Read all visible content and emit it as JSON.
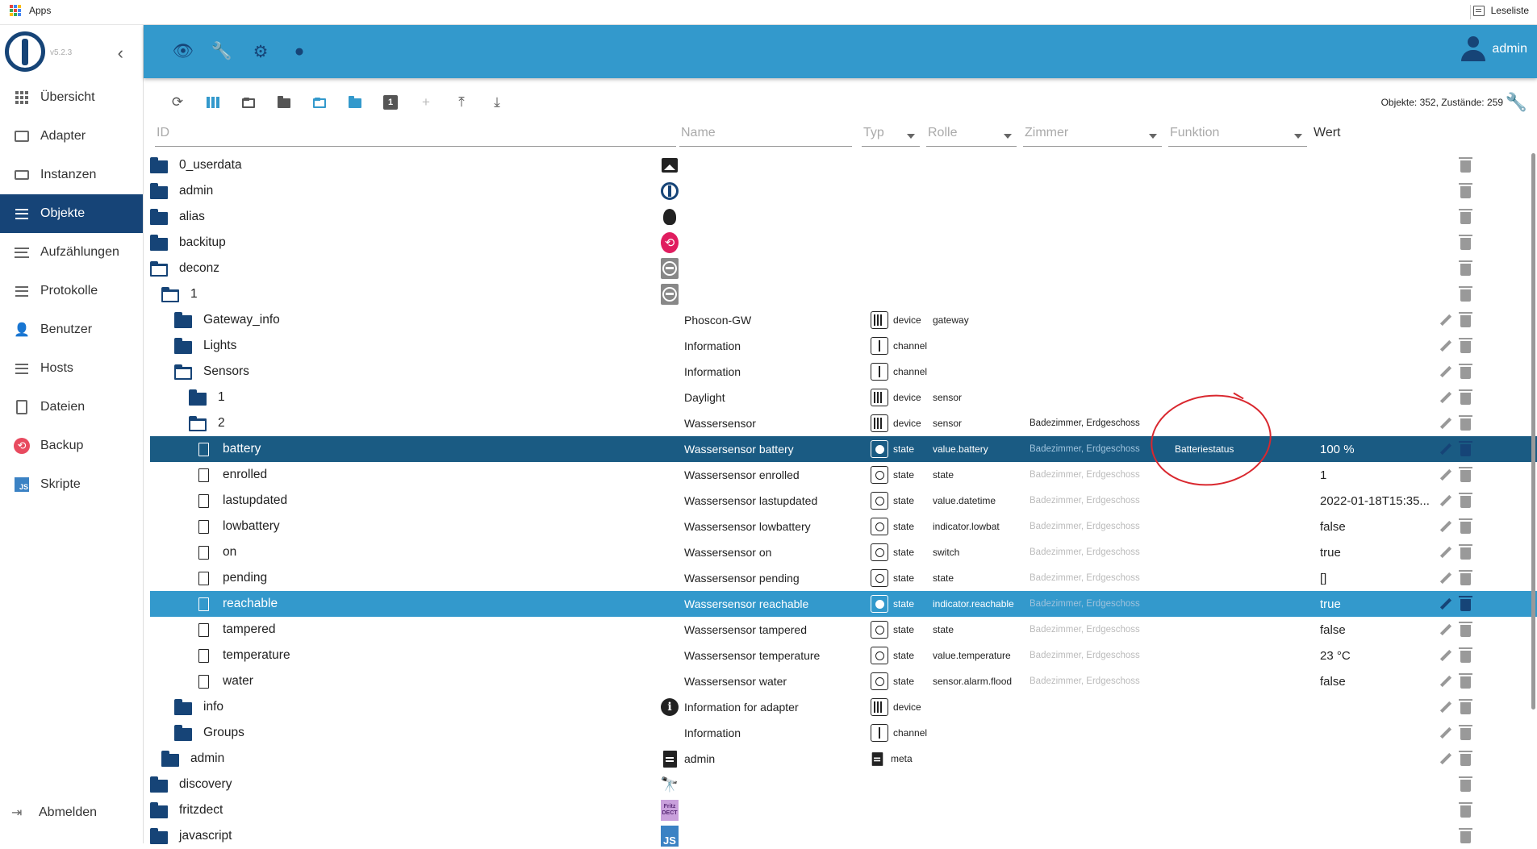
{
  "browser": {
    "apps_label": "Apps",
    "reading_list": "Leseliste"
  },
  "app": {
    "version": "v5.2.3",
    "user": "admin"
  },
  "sidebar": {
    "items": [
      {
        "label": "Übersicht",
        "icon": "grid-icon"
      },
      {
        "label": "Adapter",
        "icon": "store-icon"
      },
      {
        "label": "Instanzen",
        "icon": "instances-icon"
      },
      {
        "label": "Objekte",
        "icon": "list-icon",
        "active": true
      },
      {
        "label": "Aufzählungen",
        "icon": "enum-icon"
      },
      {
        "label": "Protokolle",
        "icon": "log-icon"
      },
      {
        "label": "Benutzer",
        "icon": "user-icon"
      },
      {
        "label": "Hosts",
        "icon": "hosts-icon"
      },
      {
        "label": "Dateien",
        "icon": "files-icon"
      },
      {
        "label": "Backup",
        "icon": "backup-icon"
      },
      {
        "label": "Skripte",
        "icon": "js-icon"
      }
    ],
    "logout": "Abmelden"
  },
  "toolbar": {
    "stats": "Objekte: 352, Zustände: 259",
    "one_badge": "1"
  },
  "columns": {
    "id": "ID",
    "name": "Name",
    "type": "Typ",
    "role": "Rolle",
    "room": "Zimmer",
    "function": "Funktion",
    "value": "Wert"
  },
  "colors": {
    "header": "#3399cc",
    "sidebar_active": "#164477",
    "selected_row": "#1a5b83",
    "highlight_row": "#3399cc",
    "annotation": "#d9282f"
  },
  "rows": [
    {
      "id": "0_userdata",
      "kind": "folder",
      "depth": 0,
      "icon": "image",
      "name": "",
      "type": "",
      "role": "",
      "room": "",
      "func": "",
      "value": ""
    },
    {
      "id": "admin",
      "kind": "folder",
      "depth": 0,
      "icon": "iob",
      "name": "",
      "type": "",
      "role": "",
      "room": "",
      "func": "",
      "value": ""
    },
    {
      "id": "alias",
      "kind": "folder",
      "depth": 0,
      "icon": "bulb",
      "name": "",
      "type": "",
      "role": "",
      "room": "",
      "func": "",
      "value": ""
    },
    {
      "id": "backitup",
      "kind": "folder",
      "depth": 0,
      "icon": "backitup",
      "name": "",
      "type": "",
      "role": "",
      "room": "",
      "func": "",
      "value": ""
    },
    {
      "id": "deconz",
      "kind": "folder-open",
      "depth": 0,
      "icon": "deconz",
      "name": "",
      "type": "",
      "role": "",
      "room": "",
      "func": "",
      "value": ""
    },
    {
      "id": "1",
      "kind": "folder-open",
      "depth": 1,
      "icon": "deconz",
      "name": "",
      "type": "",
      "role": "",
      "room": "",
      "func": "",
      "value": ""
    },
    {
      "id": "Gateway_info",
      "kind": "folder",
      "depth": 2,
      "icon": "",
      "name": "Phoscon-GW",
      "type": "device",
      "role": "gateway",
      "room": "",
      "func": "",
      "value": "",
      "edit": true
    },
    {
      "id": "Lights",
      "kind": "folder",
      "depth": 2,
      "icon": "",
      "name": "Information",
      "type": "channel",
      "role": "",
      "room": "",
      "func": "",
      "value": "",
      "edit": true
    },
    {
      "id": "Sensors",
      "kind": "folder-open",
      "depth": 2,
      "icon": "",
      "name": "Information",
      "type": "channel",
      "role": "",
      "room": "",
      "func": "",
      "value": "",
      "edit": true
    },
    {
      "id": "1",
      "kind": "folder",
      "depth": 3,
      "icon": "",
      "name": "Daylight",
      "type": "device",
      "role": "sensor",
      "room": "",
      "func": "",
      "value": "",
      "edit": true
    },
    {
      "id": "2",
      "kind": "folder-open",
      "depth": 3,
      "icon": "",
      "name": "Wassersensor",
      "type": "device",
      "role": "sensor",
      "room": "Badezimmer, Erdgeschoss",
      "room_dark": true,
      "func": "",
      "value": "",
      "edit": true
    },
    {
      "id": "battery",
      "kind": "file",
      "depth": 4,
      "icon": "",
      "name": "Wassersensor battery",
      "type": "state",
      "role": "value.battery",
      "room": "Badezimmer, Erdgeschoss",
      "func": "Batteriestatus",
      "value": "100 %",
      "edit": true,
      "sel": "dark"
    },
    {
      "id": "enrolled",
      "kind": "file",
      "depth": 4,
      "icon": "",
      "name": "Wassersensor enrolled",
      "type": "state",
      "role": "state",
      "room": "Badezimmer, Erdgeschoss",
      "func": "",
      "value": "1",
      "edit": true
    },
    {
      "id": "lastupdated",
      "kind": "file",
      "depth": 4,
      "icon": "",
      "name": "Wassersensor lastupdated",
      "type": "state",
      "role": "value.datetime",
      "room": "Badezimmer, Erdgeschoss",
      "func": "",
      "value": "2022-01-18T15:35...",
      "edit": true
    },
    {
      "id": "lowbattery",
      "kind": "file",
      "depth": 4,
      "icon": "",
      "name": "Wassersensor lowbattery",
      "type": "state",
      "role": "indicator.lowbat",
      "room": "Badezimmer, Erdgeschoss",
      "func": "",
      "value": "false",
      "edit": true
    },
    {
      "id": "on",
      "kind": "file",
      "depth": 4,
      "icon": "",
      "name": "Wassersensor on",
      "type": "state",
      "role": "switch",
      "room": "Badezimmer, Erdgeschoss",
      "func": "",
      "value": "true",
      "edit": true
    },
    {
      "id": "pending",
      "kind": "file",
      "depth": 4,
      "icon": "",
      "name": "Wassersensor pending",
      "type": "state",
      "role": "state",
      "room": "Badezimmer, Erdgeschoss",
      "func": "",
      "value": "[]",
      "edit": true
    },
    {
      "id": "reachable",
      "kind": "file",
      "depth": 4,
      "icon": "",
      "name": "Wassersensor reachable",
      "type": "state",
      "role": "indicator.reachable",
      "room": "Badezimmer, Erdgeschoss",
      "func": "",
      "value": "true",
      "edit": true,
      "sel": "blue"
    },
    {
      "id": "tampered",
      "kind": "file",
      "depth": 4,
      "icon": "",
      "name": "Wassersensor tampered",
      "type": "state",
      "role": "state",
      "room": "Badezimmer, Erdgeschoss",
      "func": "",
      "value": "false",
      "edit": true
    },
    {
      "id": "temperature",
      "kind": "file",
      "depth": 4,
      "icon": "",
      "name": "Wassersensor temperature",
      "type": "state",
      "role": "value.temperature",
      "room": "Badezimmer, Erdgeschoss",
      "func": "",
      "value": "23 °C",
      "edit": true
    },
    {
      "id": "water",
      "kind": "file",
      "depth": 4,
      "icon": "",
      "name": "Wassersensor water",
      "type": "state",
      "role": "sensor.alarm.flood",
      "room": "Badezimmer, Erdgeschoss",
      "func": "",
      "value": "false",
      "edit": true
    },
    {
      "id": "info",
      "kind": "folder",
      "depth": 2,
      "icon": "info",
      "name": "Information for adapter",
      "type": "device",
      "role": "",
      "room": "",
      "func": "",
      "value": "",
      "edit": true
    },
    {
      "id": "Groups",
      "kind": "folder",
      "depth": 2,
      "icon": "",
      "name": "Information",
      "type": "channel",
      "role": "",
      "room": "",
      "func": "",
      "value": "",
      "edit": true
    },
    {
      "id": "admin",
      "kind": "folder",
      "depth": 1,
      "icon": "doc",
      "name": "admin",
      "type": "meta",
      "role": "",
      "room": "",
      "func": "",
      "value": "",
      "edit": true
    },
    {
      "id": "discovery",
      "kind": "folder",
      "depth": 0,
      "icon": "bino",
      "name": "",
      "type": "",
      "role": "",
      "room": "",
      "func": "",
      "value": ""
    },
    {
      "id": "fritzdect",
      "kind": "folder",
      "depth": 0,
      "icon": "fritz",
      "name": "",
      "type": "",
      "role": "",
      "room": "",
      "func": "",
      "value": ""
    },
    {
      "id": "javascript",
      "kind": "folder",
      "depth": 0,
      "icon": "js",
      "name": "",
      "type": "",
      "role": "",
      "room": "",
      "func": "",
      "value": ""
    }
  ]
}
